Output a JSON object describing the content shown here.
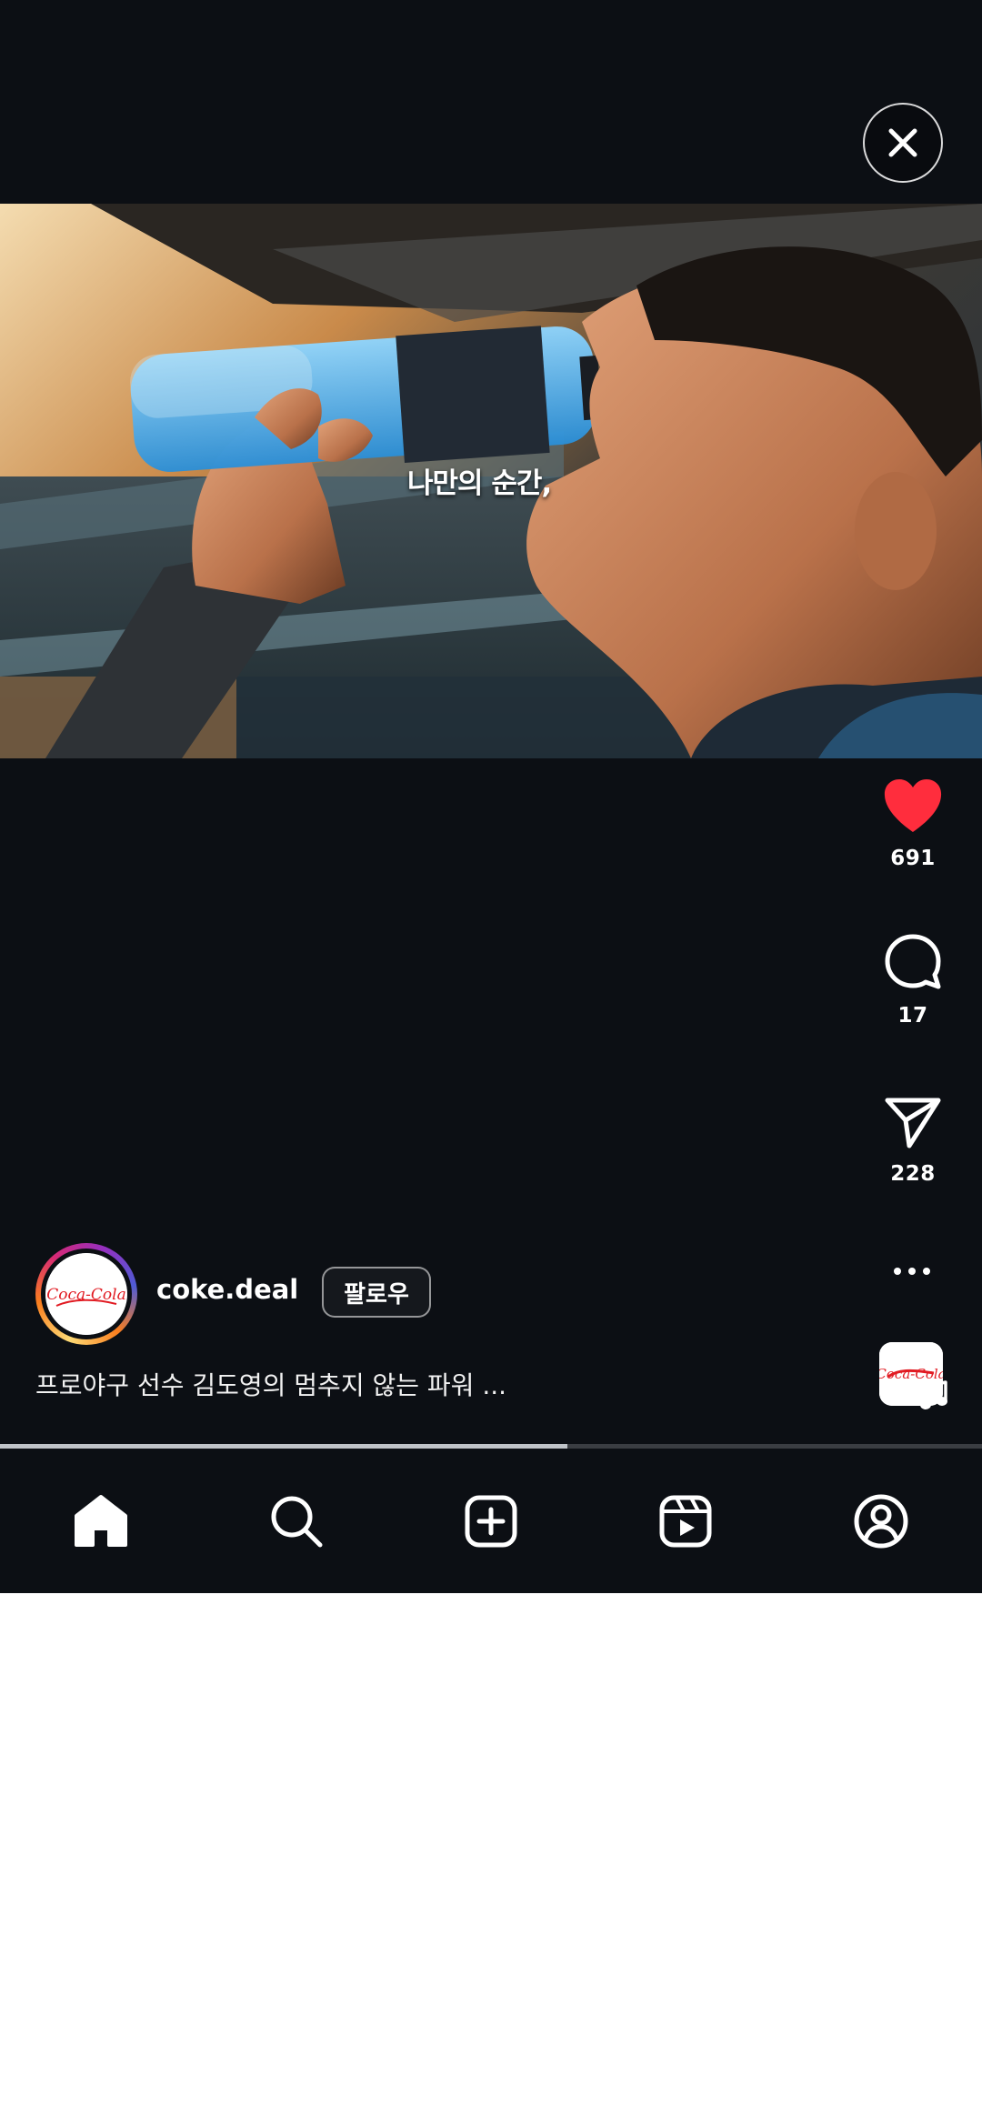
{
  "video": {
    "caption": "나만의 순간,"
  },
  "actions": {
    "like_count": "691",
    "comment_count": "17",
    "share_count": "228"
  },
  "author": {
    "username": "coke.deal",
    "follow_label": "팔로우",
    "avatar_logo_text": "Coca-Cola"
  },
  "post": {
    "caption": "프로야구 선수 김도영의 멈추지 않는 파워 ..."
  },
  "playback": {
    "progress_fraction": 0.578
  },
  "nav": {
    "items": [
      "home-icon",
      "search-icon",
      "create-icon",
      "reels-icon",
      "profile-icon"
    ]
  },
  "colors": {
    "background": "#0c0f14",
    "like_red": "#ff2d3d",
    "coke_red": "#e11b22"
  }
}
